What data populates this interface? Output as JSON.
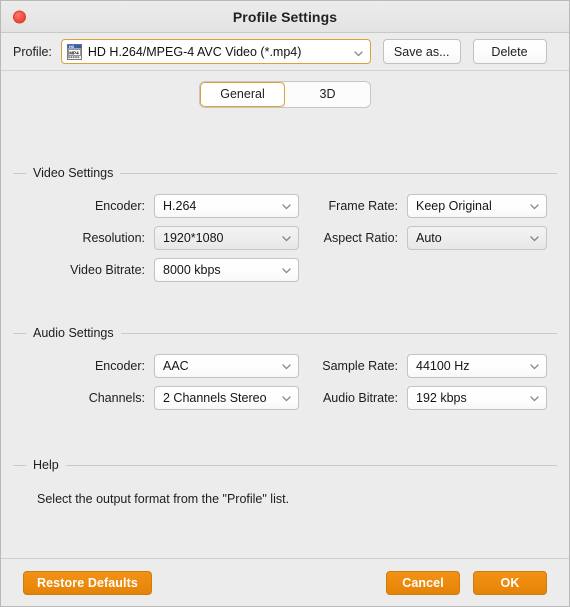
{
  "window": {
    "title": "Profile Settings",
    "close_icon": "close-icon"
  },
  "profile_bar": {
    "label": "Profile:",
    "selected_profile": "HD H.264/MPEG-4 AVC Video (*.mp4)",
    "profile_icon": "mp4-file-icon",
    "dropdown_icon": "chevron-down-icon",
    "save_as_label": "Save as...",
    "delete_label": "Delete",
    "accent_color": "#d9a339"
  },
  "tabs": [
    {
      "label": "General",
      "active": true
    },
    {
      "label": "3D",
      "active": false
    }
  ],
  "video_settings": {
    "legend": "Video Settings",
    "fields": [
      {
        "label": "Encoder:",
        "value": "H.264",
        "style": "white"
      },
      {
        "label": "Resolution:",
        "value": "1920*1080",
        "style": "gray"
      },
      {
        "label": "Video Bitrate:",
        "value": "8000 kbps",
        "style": "white"
      },
      {
        "label": "Frame Rate:",
        "value": "Keep Original",
        "style": "white"
      },
      {
        "label": "Aspect Ratio:",
        "value": "Auto",
        "style": "gray"
      }
    ]
  },
  "audio_settings": {
    "legend": "Audio Settings",
    "fields": [
      {
        "label": "Encoder:",
        "value": "AAC",
        "style": "white"
      },
      {
        "label": "Channels:",
        "value": "2 Channels Stereo",
        "style": "white"
      },
      {
        "label": "Sample Rate:",
        "value": "44100 Hz",
        "style": "white"
      },
      {
        "label": "Audio Bitrate:",
        "value": "192 kbps",
        "style": "white"
      }
    ]
  },
  "help": {
    "legend": "Help",
    "text": "Select the output format from the \"Profile\" list."
  },
  "bottom_bar": {
    "restore_defaults_label": "Restore Defaults",
    "cancel_label": "Cancel",
    "ok_label": "OK",
    "button_color": "#ec8a0c"
  }
}
